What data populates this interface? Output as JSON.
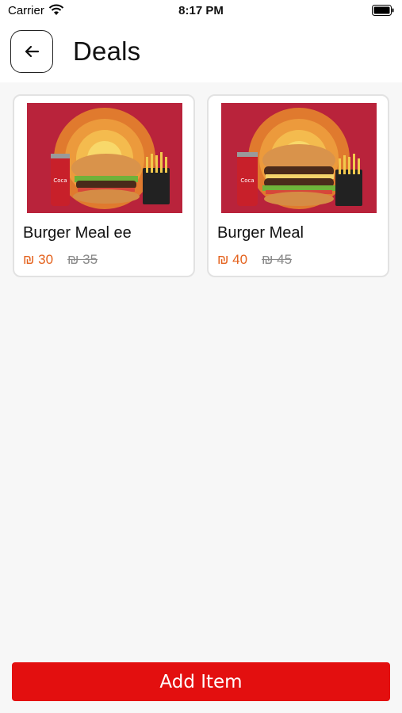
{
  "status_bar": {
    "carrier": "Carrier",
    "time": "8:17 PM",
    "icons": [
      "wifi-icon",
      "battery-icon"
    ]
  },
  "header": {
    "back_icon": "arrow-left-icon",
    "title": "Deals"
  },
  "deals": [
    {
      "name": "Burger Meal ee",
      "price": "₪ 30",
      "old_price": "₪ 35",
      "image": "burger-meal-photo"
    },
    {
      "name": "Burger Meal",
      "price": "₪ 40",
      "old_price": "₪ 45",
      "image": "burger-meal-photo"
    }
  ],
  "footer": {
    "add_item_label": "Add Item"
  },
  "colors": {
    "accent": "#e30f0f",
    "price": "#e4621d",
    "old_price": "#8a8a8a",
    "image_background": "#b9233b"
  }
}
